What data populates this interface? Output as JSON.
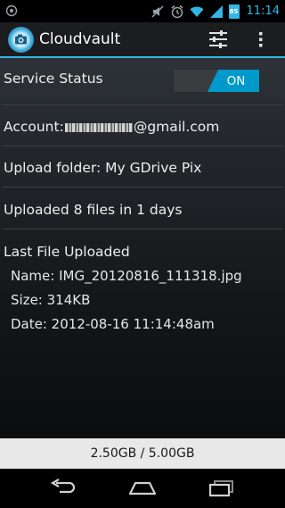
{
  "status_bar": {
    "time": "11:14",
    "battery_level": "85",
    "icons": [
      "notification-icon",
      "mute-icon",
      "alarm-icon",
      "wifi-icon",
      "signal-icon",
      "battery-icon"
    ]
  },
  "action_bar": {
    "title": "Cloudvault",
    "icons": [
      "app-camera-icon",
      "settings-sliders-icon",
      "overflow-menu-icon"
    ]
  },
  "service_status": {
    "label": "Service Status",
    "toggle_state": "ON"
  },
  "account": {
    "prefix": "Account:",
    "suffix": "@gmail.com"
  },
  "upload_folder": "Upload folder: My GDrive Pix",
  "uploaded_summary": "Uploaded 8 files in 1 days",
  "last_file": {
    "heading": "Last File Uploaded",
    "name": "Name: IMG_20120816_111318.jpg",
    "size": "Size: 314KB",
    "date": "Date: 2012-08-16 11:14:48am"
  },
  "storage": {
    "usage": "2.50GB / 5.00GB"
  },
  "nav": {
    "icons": [
      "back-icon",
      "home-icon",
      "recents-icon"
    ]
  },
  "colors": {
    "accent": "#33b5e5",
    "toggle_on": "#0099cc"
  }
}
